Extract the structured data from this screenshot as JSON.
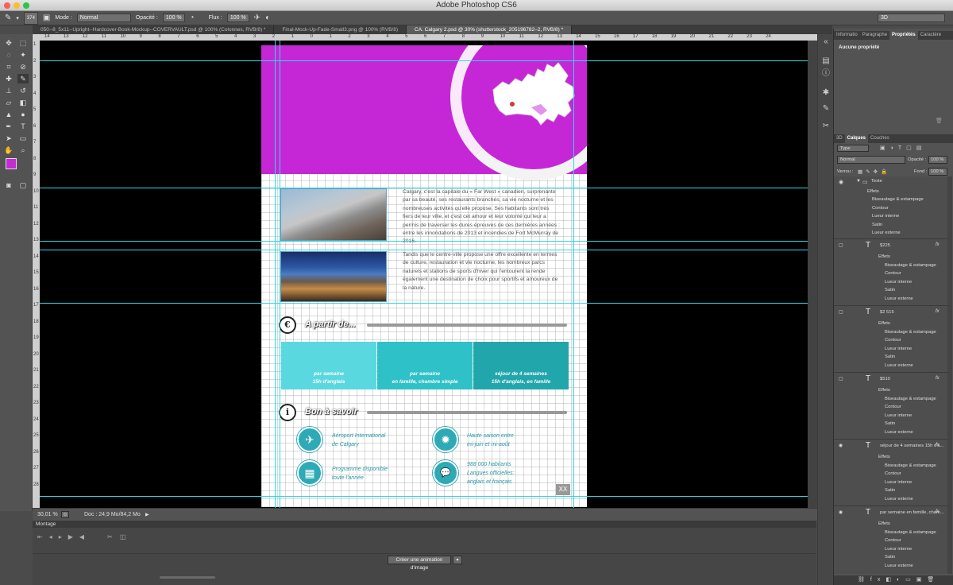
{
  "app": {
    "title": "Adobe Photoshop CS6",
    "workspace": "3D"
  },
  "options_bar": {
    "brush_size": "374",
    "mode_label": "Mode :",
    "mode_value": "Normal",
    "opacity_label": "Opacité :",
    "opacity_value": "100 %",
    "flow_label": "Flux :",
    "flow_value": "100 %"
  },
  "doc_tabs": [
    {
      "label": "050--8_5x11--Upright--Hardcover-Book-Mockup--COVERVAULT.psd @ 100% (Colonnes, RVB/8) *"
    },
    {
      "label": "Final-Mock-Up-Fade-Small3.png @ 100% (RVB/8)"
    },
    {
      "label": "CA. Calgary 2.psd @ 30% (shutterstock_205196782–2, RVB/8) *"
    }
  ],
  "ruler_h_labels": [
    "14",
    "13",
    "12",
    "11",
    "10",
    "9",
    "8",
    "7",
    "6",
    "5",
    "4",
    "3",
    "2",
    "1",
    "0",
    "1",
    "2",
    "3",
    "4",
    "5",
    "6",
    "7",
    "8",
    "9",
    "10",
    "11",
    "12",
    "13",
    "14",
    "15",
    "16",
    "17",
    "18",
    "19",
    "20",
    "21",
    "22",
    "23",
    "24"
  ],
  "ruler_v_labels": [
    "1",
    "2",
    "3",
    "4",
    "5",
    "6",
    "7",
    "8",
    "9",
    "10",
    "11",
    "12",
    "13",
    "14",
    "15",
    "16",
    "17",
    "18",
    "19",
    "20",
    "21",
    "22",
    "23",
    "24",
    "25",
    "26",
    "27",
    "28"
  ],
  "document": {
    "para1": "Calgary, c'est la capitale du « Far West » canadien, surprenante par sa beauté, ses restaurants branchés, sa vie nocturne et les nombreuses activités qu'elle propose. Ses habitants sont très fiers de leur ville, et c'est cet amour et leur volonté qui leur a permis de traverser les dures épreuves de ces dernières années : entre les innondations de 2013 et incendies de Fort McMurray de 2016.",
    "para2": "Tandis que le centre-ville propose une offre excellente en termes de culture, restauration et vie nocturne, les nombreux parcs naturels et stations de sports d'hiver qui l'entourent la rende également une destination de choix pour sportifs et amoureux de la nature.",
    "section1_icon": "€",
    "section1_title": "A partir de...",
    "section2_icon": "i",
    "section2_title": "Bon à savoir",
    "pricing": [
      {
        "line1": "par semaine",
        "line2": "15h d'anglais",
        "color": "#5ad8e0"
      },
      {
        "line1": "par semaine",
        "line2": "en famille, chambre simple",
        "color": "#2fc1c8"
      },
      {
        "line1": "séjour de 4 semaines",
        "line2": "15h d'anglais, en famille",
        "color": "#20a6ab"
      }
    ],
    "features": [
      {
        "icon": "✈",
        "icon_name": "airplane-icon",
        "line1": "Aéroport International",
        "line2": "de Calgary"
      },
      {
        "icon": "✹",
        "icon_name": "sun-icon",
        "line1": "Haute saison entre",
        "line2": "mi-juin et mi-août"
      },
      {
        "icon": "▦",
        "icon_name": "calendar-icon",
        "line1": "Programme disponible",
        "line2": "toute l'année"
      },
      {
        "icon": "💬",
        "icon_name": "speech-bubble-icon",
        "line1": "988 000 habitants",
        "line2": "Langues officielles:",
        "line3": "anglais et français"
      }
    ],
    "corner_mark": "XX",
    "header_color": "#c627d6",
    "accent_color": "#2daab5"
  },
  "status": {
    "zoom": "30,01 %",
    "doc": "Doc : 24,9 Mo/84,2 Mo"
  },
  "timeline": {
    "title": "Montage",
    "create_button": "Créer une animation d'image"
  },
  "properties_panel": {
    "tabs": [
      "Informatio",
      "Paragraphe",
      "Propriétés",
      "Caractère"
    ],
    "active_tab": "Propriétés",
    "body": "Aucune propriété"
  },
  "layers_panel": {
    "tabs": [
      "3D",
      "Calques",
      "Couches"
    ],
    "active_tab": "Calques",
    "filter_value": "Type",
    "blend_mode": "Normal",
    "opacity_label": "Opacité :",
    "opacity_value": "100 %",
    "lock_label": "Verrou :",
    "fill_label": "Fond :",
    "fill_value": "100 %",
    "group_name": "Texte",
    "group_effects": [
      "Effets",
      "Biseautage & estampage",
      "Contour",
      "Lueur interne",
      "Satin",
      "Lueur externe"
    ],
    "text_layers": [
      {
        "name": "$225"
      },
      {
        "name": "$2 515"
      },
      {
        "name": "$510"
      },
      {
        "name": "séjour de 4 semaines 15h d'a..."
      },
      {
        "name": "par semaine en famille, cham..."
      }
    ],
    "effects": [
      "Effets",
      "Biseautage & estampage",
      "Contour",
      "Lueur interne",
      "Satin",
      "Lueur externe"
    ]
  }
}
